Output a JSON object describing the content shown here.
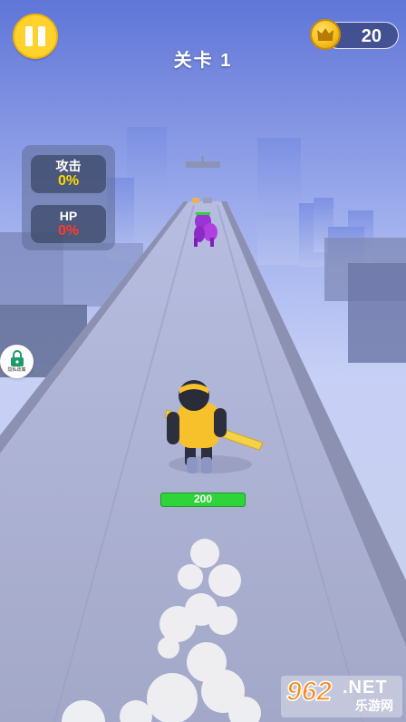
{
  "hud": {
    "pause_icon": "pause-icon",
    "level_title": "关卡 1",
    "coins": {
      "value": "20",
      "icon": "crown-coin-icon"
    }
  },
  "stats": {
    "attack_label": "攻击",
    "attack_value": "0%",
    "hp_label": "HP",
    "hp_value": "0%"
  },
  "side_badge": {
    "icon": "lock-icon",
    "text": "隐私政策"
  },
  "player": {
    "health": "200"
  },
  "watermark": {
    "number": "962",
    "domain": ".NET",
    "name": "乐游网"
  },
  "colors": {
    "sky_top": "#5f76d8",
    "road": "#a5aacb",
    "pause_button": "#ffd22e",
    "attack_value": "#ffd600",
    "hp_value": "#ff3a2a",
    "health_bar": "#2fd33a",
    "player_shirt": "#f7c12b",
    "enemy": "#a23ad6"
  }
}
